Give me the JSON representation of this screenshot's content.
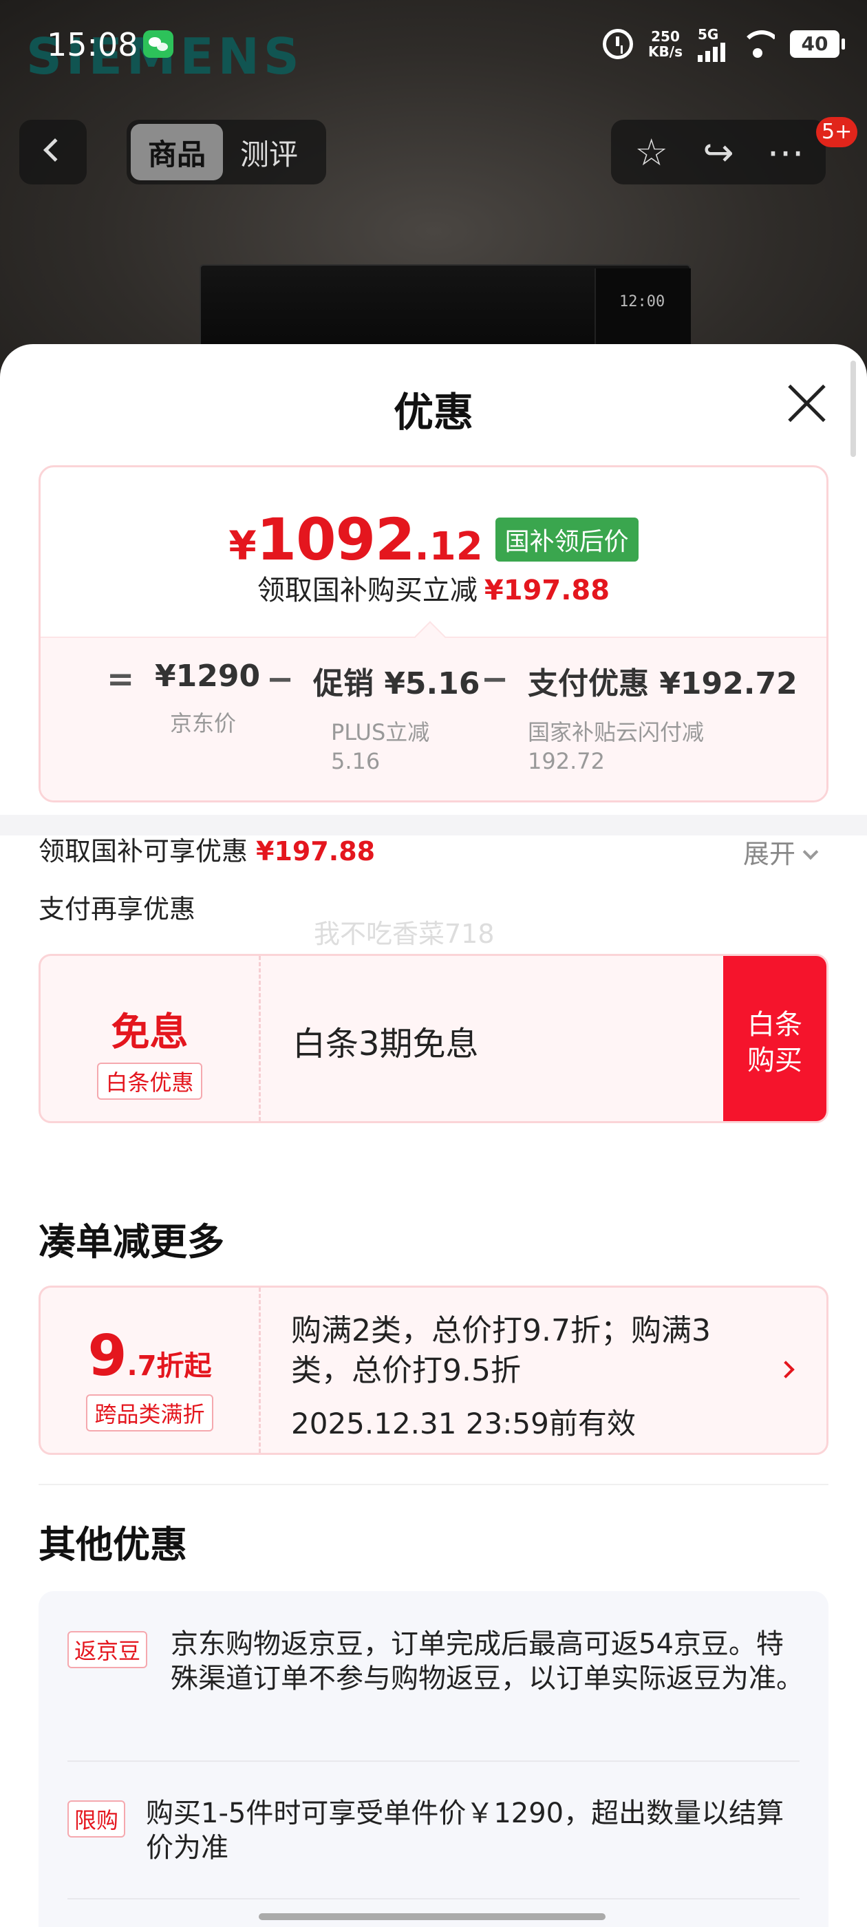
{
  "status_bar": {
    "time": "15:08",
    "net_speed_value": "250",
    "net_speed_unit": "KB/s",
    "signal": "5G",
    "battery": "40"
  },
  "background": {
    "brand": "SIEMENS",
    "product_clock": "12:00"
  },
  "nav": {
    "tabs": [
      {
        "label": "商品",
        "active": true
      },
      {
        "label": "测评",
        "active": false
      }
    ],
    "badge": "5+"
  },
  "sheet": {
    "title": "优惠",
    "price_card": {
      "currency": "¥",
      "price_int": "1092",
      "price_dec": ".12",
      "price_tag": "国补领后价",
      "saving_text": "领取国补购买立减",
      "saving_amount": "¥197.88",
      "breakdown": {
        "eq": "=",
        "minus": "−",
        "jd_price": "¥1290",
        "jd_label": "京东价",
        "promo_price": "促销 ¥5.16",
        "promo_label_1": "PLUS立减",
        "promo_label_2": "5.16",
        "pay_price": "支付优惠 ¥192.72",
        "pay_label_1": "国家补贴云闪付减",
        "pay_label_2": "192.72"
      }
    },
    "subsidy_row": {
      "label": "领取国补可享优惠",
      "amount": "¥197.88",
      "expand_label": "展开"
    },
    "pay_more_label": "支付再享优惠",
    "watermark": "我不吃香菜718",
    "baitiao_coupon": {
      "big": "免息",
      "tag": "白条优惠",
      "text": "白条3期免息",
      "button_line1": "白条",
      "button_line2": "购买"
    },
    "more_section": {
      "title": "凑单减更多",
      "coupon": {
        "big_number": "9",
        "big_suffix": ".7折起",
        "tag": "跨品类满折",
        "text": "购满2类，总价打9.7折；购满3类，总价打9.5折",
        "date": "2025.12.31 23:59前有效"
      }
    },
    "other_section": {
      "title": "其他优惠",
      "items": [
        {
          "tag": "返京豆",
          "text": "京东购物返京豆，订单完成后最高可返54京豆。特殊渠道订单不参与购物返豆，以订单实际返豆为准。"
        },
        {
          "tag": "限购",
          "text": "购买1-5件时可享受单件价￥1290，超出数量以结算价为准"
        }
      ]
    }
  },
  "colors": {
    "accent_red": "#e4161e",
    "tag_green": "#3aa64e",
    "button_red": "#f5142c"
  }
}
